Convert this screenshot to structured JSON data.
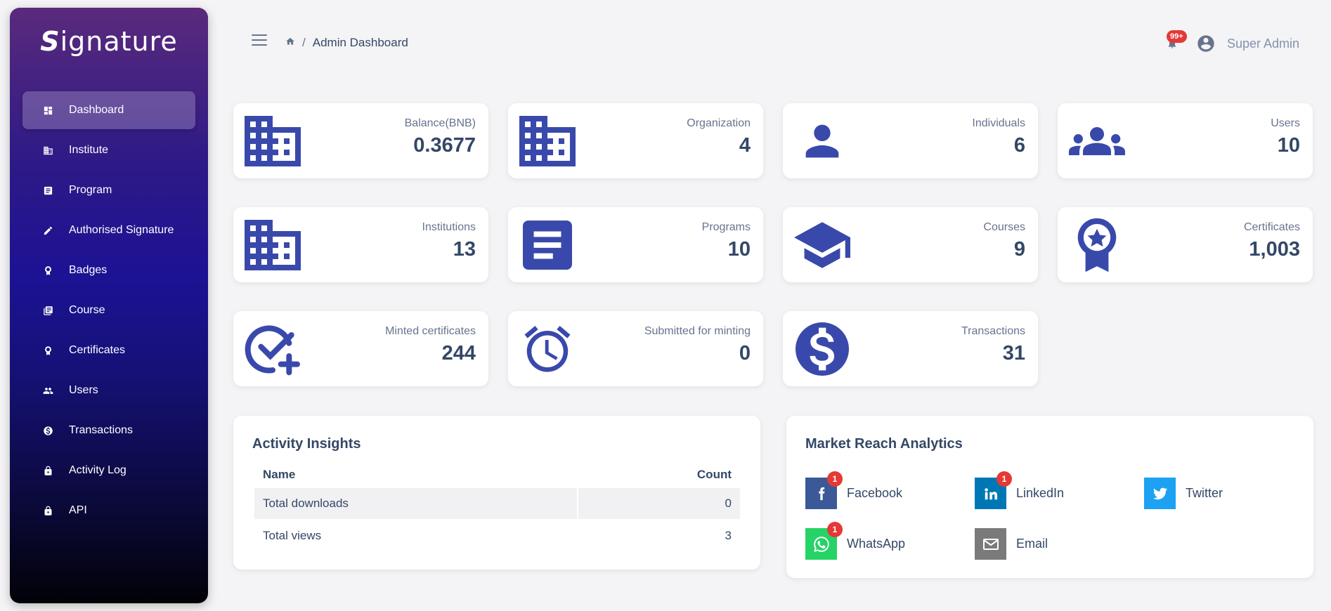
{
  "sidebar": {
    "logo": "ignature",
    "logo_mark": "S",
    "items": [
      {
        "label": "Dashboard",
        "icon": "dashboard-icon"
      },
      {
        "label": "Institute",
        "icon": "building-icon"
      },
      {
        "label": "Program",
        "icon": "document-icon"
      },
      {
        "label": "Authorised Signature",
        "icon": "pencil-icon"
      },
      {
        "label": "Badges",
        "icon": "badge-icon"
      },
      {
        "label": "Course",
        "icon": "library-icon"
      },
      {
        "label": "Certificates",
        "icon": "badge-icon"
      },
      {
        "label": "Users",
        "icon": "users-icon"
      },
      {
        "label": "Transactions",
        "icon": "dollar-icon"
      },
      {
        "label": "Activity Log",
        "icon": "lock-icon"
      },
      {
        "label": "API",
        "icon": "lock-icon"
      }
    ]
  },
  "header": {
    "breadcrumb_sep": "/",
    "breadcrumb_current": "Admin Dashboard",
    "notification_count": "99+",
    "user_name": "Super Admin"
  },
  "stats": [
    {
      "label": "Balance(BNB)",
      "value": "0.3677",
      "icon": "building-icon"
    },
    {
      "label": "Organization",
      "value": "4",
      "icon": "building-icon"
    },
    {
      "label": "Individuals",
      "value": "6",
      "icon": "person-icon"
    },
    {
      "label": "Users",
      "value": "10",
      "icon": "group-icon"
    },
    {
      "label": "Institutions",
      "value": "13",
      "icon": "building-icon"
    },
    {
      "label": "Programs",
      "value": "10",
      "icon": "article-icon"
    },
    {
      "label": "Courses",
      "value": "9",
      "icon": "graduation-cap-icon"
    },
    {
      "label": "Certificates",
      "value": "1,003",
      "icon": "award-icon"
    },
    {
      "label": "Minted certificates",
      "value": "244",
      "icon": "check-plus-icon"
    },
    {
      "label": "Submitted for minting",
      "value": "0",
      "icon": "alarm-clock-icon"
    },
    {
      "label": "Transactions",
      "value": "31",
      "icon": "dollar-circle-icon"
    }
  ],
  "activity": {
    "title": "Activity Insights",
    "columns": [
      "Name",
      "Count"
    ],
    "rows": [
      {
        "name": "Total downloads",
        "count": "0"
      },
      {
        "name": "Total views",
        "count": "3"
      }
    ]
  },
  "market": {
    "title": "Market Reach Analytics",
    "items": [
      {
        "label": "Facebook",
        "count": "1",
        "color": "#3b5998"
      },
      {
        "label": "LinkedIn",
        "count": "1",
        "color": "#0077b5"
      },
      {
        "label": "Twitter",
        "count": "",
        "color": "#1da1f2"
      },
      {
        "label": "WhatsApp",
        "count": "1",
        "color": "#25d366"
      },
      {
        "label": "Email",
        "count": "",
        "color": "#7a7a7a"
      }
    ]
  },
  "colors": {
    "accent": "#3949ab",
    "badge": "#e53935"
  }
}
